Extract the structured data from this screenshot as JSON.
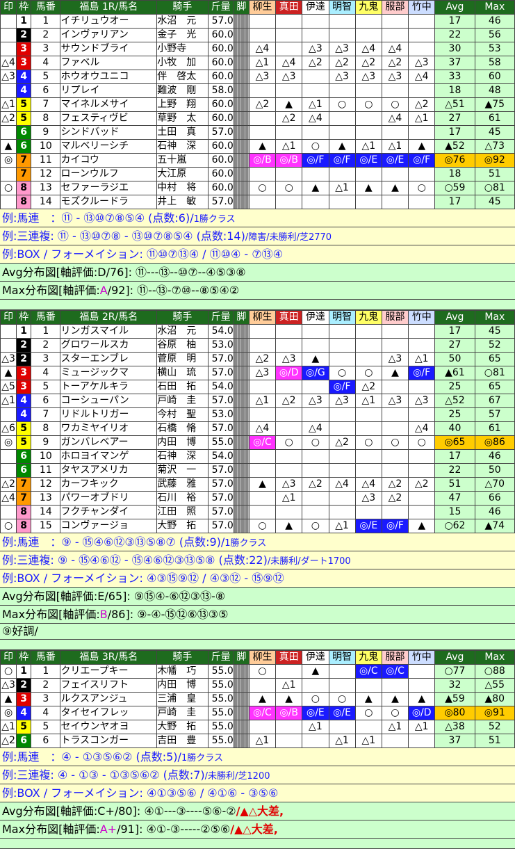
{
  "headers": {
    "mark": "印",
    "waku": "枠",
    "umaban": "馬番",
    "jockey": "騎手",
    "weight": "斤量",
    "leg": "脚",
    "predictors": [
      "柳生",
      "真田",
      "伊達",
      "明智",
      "九鬼",
      "服部",
      "竹中"
    ],
    "avg": "Avg",
    "max": "Max"
  },
  "races": [
    {
      "title": "福島 1R/馬名",
      "horses": [
        {
          "mark": "",
          "waku": "1",
          "num": "1",
          "name": "イチリュウオー",
          "jockey": "水沼　元",
          "weight": "57.0",
          "preds": [
            "",
            "",
            "",
            "",
            "",
            "",
            ""
          ],
          "avg": "17",
          "max": "46",
          "hl": false
        },
        {
          "mark": "",
          "waku": "2",
          "num": "2",
          "name": "インヴァリアン",
          "jockey": "金子　光",
          "weight": "60.0",
          "preds": [
            "",
            "",
            "",
            "",
            "",
            "",
            ""
          ],
          "avg": "22",
          "max": "56",
          "hl": false
        },
        {
          "mark": "",
          "waku": "3",
          "num": "3",
          "name": "サウンドブライ",
          "jockey": "小野寺",
          "weight": "60.0",
          "preds": [
            "△4",
            "",
            "△3",
            "△3",
            "△4",
            "△4",
            ""
          ],
          "avg": "30",
          "max": "53",
          "hl": false
        },
        {
          "mark": "△4",
          "waku": "3",
          "num": "4",
          "name": "ファベル",
          "jockey": "小牧　加",
          "weight": "60.0",
          "preds": [
            "△1",
            "△4",
            "△2",
            "△2",
            "△2",
            "△2",
            "△3"
          ],
          "avg": "37",
          "max": "58",
          "hl": false
        },
        {
          "mark": "△3",
          "waku": "4",
          "num": "5",
          "name": "ホウオウユニコ",
          "jockey": "伴　啓太",
          "weight": "60.0",
          "preds": [
            "△3",
            "△3",
            "",
            "△3",
            "△3",
            "△3",
            "△4"
          ],
          "avg": "33",
          "max": "60",
          "hl": false
        },
        {
          "mark": "",
          "waku": "4",
          "num": "6",
          "name": "リプレイ",
          "jockey": "難波　剛",
          "weight": "58.0",
          "preds": [
            "",
            "",
            "",
            "",
            "",
            "",
            ""
          ],
          "avg": "18",
          "max": "48",
          "hl": false
        },
        {
          "mark": "△1",
          "waku": "5",
          "num": "7",
          "name": "マイネルメサイ",
          "jockey": "上野　翔",
          "weight": "60.0",
          "preds": [
            "△2",
            "▲",
            "△1",
            "○",
            "○",
            "○",
            "△2"
          ],
          "avg": "△51",
          "max": "▲75",
          "hl": false
        },
        {
          "mark": "△2",
          "waku": "5",
          "num": "8",
          "name": "フェスティヴビ",
          "jockey": "草野　太",
          "weight": "60.0",
          "preds": [
            "",
            "△2",
            "△4",
            "",
            "",
            "△4",
            "△1"
          ],
          "avg": "27",
          "max": "61",
          "hl": false
        },
        {
          "mark": "",
          "waku": "6",
          "num": "9",
          "name": "シンドバッド",
          "jockey": "土田　真",
          "weight": "57.0",
          "preds": [
            "",
            "",
            "",
            "",
            "",
            "",
            ""
          ],
          "avg": "17",
          "max": "45",
          "hl": false
        },
        {
          "mark": "▲",
          "waku": "6",
          "num": "10",
          "name": "マルベリーシチ",
          "jockey": "石神　深",
          "weight": "60.0",
          "preds": [
            "▲",
            "△1",
            "○",
            "▲",
            "△1",
            "△1",
            "▲"
          ],
          "avg": "▲52",
          "max": "△73",
          "hl": false
        },
        {
          "mark": "◎",
          "waku": "7",
          "num": "11",
          "name": "カイコウ",
          "jockey": "五十嵐",
          "weight": "60.0",
          "preds": [
            "◎/B",
            "◎/B",
            "◎/F",
            "◎/F",
            "◎/E",
            "◎/E",
            "◎/F"
          ],
          "avg": "◎76",
          "max": "◎92",
          "hl": true
        },
        {
          "mark": "",
          "waku": "7",
          "num": "12",
          "name": "ローンウルフ",
          "jockey": "大江原",
          "weight": "60.0",
          "preds": [
            "",
            "",
            "",
            "",
            "",
            "",
            ""
          ],
          "avg": "18",
          "max": "51",
          "hl": false
        },
        {
          "mark": "○",
          "waku": "8",
          "num": "13",
          "name": "セファーラジエ",
          "jockey": "中村　将",
          "weight": "60.0",
          "preds": [
            "○",
            "○",
            "▲",
            "△1",
            "▲",
            "▲",
            "○"
          ],
          "avg": "○59",
          "max": "○81",
          "hl": false
        },
        {
          "mark": "",
          "waku": "8",
          "num": "14",
          "name": "モズクルードラ",
          "jockey": "井上　敏",
          "weight": "57.0",
          "preds": [
            "",
            "",
            "",
            "",
            "",
            "",
            ""
          ],
          "avg": "17",
          "max": "45",
          "hl": false
        }
      ],
      "umaren": "例:馬連　：⑪ - ⑬⑩⑦⑧⑤④ (点数:6)/",
      "cls": "1勝クラス",
      "sanrenpuku": "例:三連複: ⑪ - ⑬⑩⑦⑧ - ⑬⑩⑦⑧⑤④ (点数:14)",
      "cond": "/障害/未勝利/芝2770",
      "box": "例:BOX / フォーメイション: ⑪⑩⑦⑬④ / ⑪⑩④ - ⑦⑬④",
      "avgdist": "Avg分布図[軸評価:D/76]: ⑪---⑬--⑩⑦--④⑤③⑧",
      "maxdist_pre": "Max分布図[軸評価:",
      "maxdist_grade": "A",
      "maxdist_post": "/92]: ⑪--⑬-⑦⑩--⑧⑤④②",
      "note": ""
    },
    {
      "title": "福島 2R/馬名",
      "horses": [
        {
          "mark": "",
          "waku": "1",
          "num": "1",
          "name": "リンガスマイル",
          "jockey": "水沼　元",
          "weight": "54.0",
          "preds": [
            "",
            "",
            "",
            "",
            "",
            "",
            ""
          ],
          "avg": "17",
          "max": "45",
          "hl": false
        },
        {
          "mark": "",
          "waku": "2",
          "num": "2",
          "name": "グロワールスカ",
          "jockey": "谷原　柚",
          "weight": "53.0",
          "preds": [
            "",
            "",
            "",
            "",
            "",
            "",
            ""
          ],
          "avg": "27",
          "max": "52",
          "hl": false
        },
        {
          "mark": "△3",
          "waku": "2",
          "num": "3",
          "name": "スターエンブレ",
          "jockey": "菅原　明",
          "weight": "57.0",
          "preds": [
            "△2",
            "△3",
            "▲",
            "",
            "",
            "△3",
            "△1"
          ],
          "avg": "50",
          "max": "65",
          "hl": false
        },
        {
          "mark": "▲",
          "waku": "3",
          "num": "4",
          "name": "ミュージックマ",
          "jockey": "横山　琉",
          "weight": "57.0",
          "preds": [
            "△3",
            "◎/D",
            "◎/G",
            "○",
            "○",
            "▲",
            "◎/F"
          ],
          "avg": "▲61",
          "max": "○81",
          "hl": false
        },
        {
          "mark": "△5",
          "waku": "3",
          "num": "5",
          "name": "トーアケルキラ",
          "jockey": "石田　拓",
          "weight": "54.0",
          "preds": [
            "",
            "",
            "",
            "◎/F",
            "△2",
            "",
            ""
          ],
          "avg": "25",
          "max": "65",
          "hl": false
        },
        {
          "mark": "△1",
          "waku": "4",
          "num": "6",
          "name": "コーシューパン",
          "jockey": "戸崎　圭",
          "weight": "57.0",
          "preds": [
            "△1",
            "△2",
            "△3",
            "△3",
            "△1",
            "△3",
            "△3"
          ],
          "avg": "△52",
          "max": "67",
          "hl": false
        },
        {
          "mark": "",
          "waku": "4",
          "num": "7",
          "name": "リドルトリガー",
          "jockey": "今村　聖",
          "weight": "53.0",
          "preds": [
            "",
            "",
            "",
            "",
            "",
            "",
            ""
          ],
          "avg": "25",
          "max": "57",
          "hl": false
        },
        {
          "mark": "△6",
          "waku": "5",
          "num": "8",
          "name": "ワカミヤイリオ",
          "jockey": "石橋　脩",
          "weight": "57.0",
          "preds": [
            "△4",
            "",
            "△4",
            "",
            "",
            "",
            "△4"
          ],
          "avg": "40",
          "max": "61",
          "hl": false
        },
        {
          "mark": "◎",
          "waku": "5",
          "num": "9",
          "name": "ガンバレベアー",
          "jockey": "内田　博",
          "weight": "55.0",
          "preds": [
            "◎/C",
            "○",
            "○",
            "△2",
            "○",
            "○",
            "○"
          ],
          "avg": "◎65",
          "max": "◎86",
          "hl": true
        },
        {
          "mark": "",
          "waku": "6",
          "num": "10",
          "name": "ホロヨイマンゲ",
          "jockey": "石神　深",
          "weight": "54.0",
          "preds": [
            "",
            "",
            "",
            "",
            "",
            "",
            ""
          ],
          "avg": "17",
          "max": "46",
          "hl": false
        },
        {
          "mark": "",
          "waku": "6",
          "num": "11",
          "name": "タヤスアメリカ",
          "jockey": "菊沢　一",
          "weight": "57.0",
          "preds": [
            "",
            "",
            "",
            "",
            "",
            "",
            ""
          ],
          "avg": "22",
          "max": "50",
          "hl": false
        },
        {
          "mark": "△2",
          "waku": "7",
          "num": "12",
          "name": "カーフキック",
          "jockey": "武藤　雅",
          "weight": "57.0",
          "preds": [
            "▲",
            "△3",
            "△2",
            "△4",
            "△4",
            "△2",
            "△2"
          ],
          "avg": "51",
          "max": "△70",
          "hl": false
        },
        {
          "mark": "△4",
          "waku": "7",
          "num": "13",
          "name": "パワーオブドリ",
          "jockey": "石川　裕",
          "weight": "57.0",
          "preds": [
            "",
            "△1",
            "",
            "",
            "△3",
            "△2",
            ""
          ],
          "avg": "47",
          "max": "66",
          "hl": false
        },
        {
          "mark": "",
          "waku": "8",
          "num": "14",
          "name": "フクチャンダイ",
          "jockey": "江田　照",
          "weight": "57.0",
          "preds": [
            "",
            "",
            "",
            "",
            "",
            "",
            ""
          ],
          "avg": "15",
          "max": "46",
          "hl": false
        },
        {
          "mark": "○",
          "waku": "8",
          "num": "15",
          "name": "コンヴァージョ",
          "jockey": "大野　拓",
          "weight": "57.0",
          "preds": [
            "○",
            "▲",
            "○",
            "△1",
            "◎/E",
            "◎/F",
            "▲"
          ],
          "avg": "○62",
          "max": "▲74",
          "hl": false
        }
      ],
      "umaren": "例:馬連　：⑨ - ⑮④⑥⑫③⑬⑤⑧⑦ (点数:9)/",
      "cls": "1勝クラス",
      "sanrenpuku": "例:三連複: ⑨ - ⑮④⑥⑫ - ⑮④⑥⑫③⑬⑤⑧ (点数:22)",
      "cond": "/未勝利/ダート1700",
      "box": "例:BOX / フォーメイション: ④③⑮⑨⑫ / ④③⑫ - ⑮⑨⑫",
      "avgdist": "Avg分布図[軸評価:E/65]: ⑨⑮④-⑥⑫③⑬-⑧",
      "maxdist_pre": "Max分布図[軸評価:",
      "maxdist_grade": "B",
      "maxdist_post": "/86]: ⑨-④-⑮⑫⑥⑬③⑤",
      "note": "⑨好調/"
    },
    {
      "title": "福島 3R/馬名",
      "horses": [
        {
          "mark": "○",
          "waku": "1",
          "num": "1",
          "name": "クリエープキー",
          "jockey": "木幡　巧",
          "weight": "55.0",
          "preds": [
            "○",
            "",
            "▲",
            "",
            "◎/C",
            "◎/C",
            ""
          ],
          "avg": "○77",
          "max": "○88",
          "hl": false
        },
        {
          "mark": "△3",
          "waku": "2",
          "num": "2",
          "name": "フェイスリフト",
          "jockey": "内田　博",
          "weight": "55.0",
          "preds": [
            "",
            "△1",
            "",
            "",
            "",
            "",
            ""
          ],
          "avg": "32",
          "max": "△55",
          "hl": false
        },
        {
          "mark": "▲",
          "waku": "3",
          "num": "3",
          "name": "ルクスアンジュ",
          "jockey": "三浦　皇",
          "weight": "55.0",
          "preds": [
            "▲",
            "▲",
            "○",
            "○",
            "▲",
            "▲",
            "▲"
          ],
          "avg": "▲59",
          "max": "▲80",
          "hl": false
        },
        {
          "mark": "◎",
          "waku": "4",
          "num": "4",
          "name": "タイセイフレッ",
          "jockey": "戸崎　圭",
          "weight": "55.0",
          "preds": [
            "◎/C",
            "◎/B",
            "◎/E",
            "◎/E",
            "○",
            "○",
            "◎/D"
          ],
          "avg": "◎80",
          "max": "◎91",
          "hl": true
        },
        {
          "mark": "△1",
          "waku": "5",
          "num": "5",
          "name": "セイウンヤオヨ",
          "jockey": "大野　拓",
          "weight": "55.0",
          "preds": [
            "",
            "",
            "△1",
            "",
            "",
            "△1",
            "△1"
          ],
          "avg": "△38",
          "max": "52",
          "hl": false
        },
        {
          "mark": "△2",
          "waku": "6",
          "num": "6",
          "name": "トラスコンガー",
          "jockey": "吉田　豊",
          "weight": "55.0",
          "preds": [
            "△1",
            "",
            "",
            "△1",
            "△1",
            "",
            ""
          ],
          "avg": "37",
          "max": "51",
          "hl": false
        }
      ],
      "umaren": "例:馬連　：④ - ①③⑤⑥② (点数:5)/",
      "cls": "1勝クラス",
      "sanrenpuku": "例:三連複: ④ - ①③ - ①③⑤⑥② (点数:7)",
      "cond": "/未勝利/芝1200",
      "box": "例:BOX / フォーメイション: ④①③⑤⑥ / ④①⑥ - ③⑤⑥",
      "avgdist": "Avg分布図[軸評価:C+/80]: ④①---③----⑤⑥-②",
      "avg_alert": "/▲△大差,",
      "maxdist_pre": "Max分布図[軸評価:",
      "maxdist_grade": "A+",
      "maxdist_post": "/91]: ④①-③-----②⑤⑥",
      "max_alert": "/▲△大差,",
      "note": ""
    }
  ]
}
